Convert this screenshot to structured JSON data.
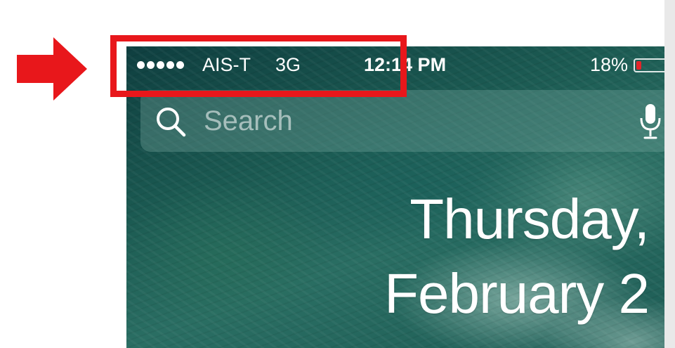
{
  "status_bar": {
    "signal_dots": 5,
    "carrier": "AIS-T",
    "network": "3G",
    "time": "12:14 PM",
    "battery_percent_label": "18%",
    "battery_level": 0.18,
    "battery_color": "#e3252a"
  },
  "search": {
    "placeholder": "Search",
    "icons": [
      "search-icon",
      "microphone-icon"
    ]
  },
  "date": {
    "day": "Thursday,",
    "date": "February 2"
  },
  "annotation": {
    "highlight_color": "#e8171b",
    "arrow_icon": "right-arrow-icon"
  }
}
